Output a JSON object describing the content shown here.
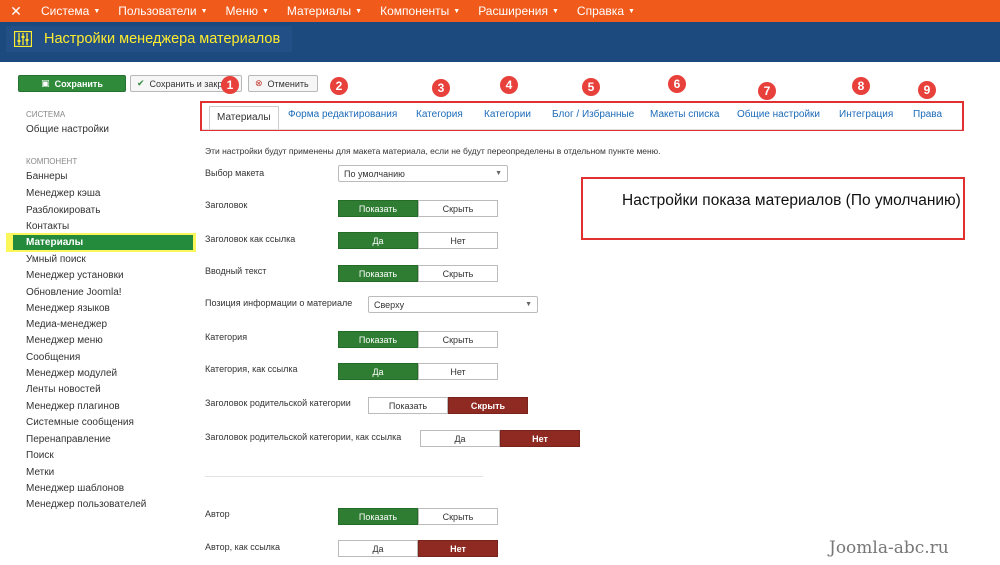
{
  "topnav": {
    "logo": "✕",
    "items": [
      "Система",
      "Пользователи",
      "Меню",
      "Материалы",
      "Компоненты",
      "Расширения",
      "Справка"
    ]
  },
  "header": {
    "title": "Настройки менеджера материалов"
  },
  "toolbar": {
    "save": "Сохранить",
    "save_close": "Сохранить и закрыть",
    "cancel": "Отменить"
  },
  "sidebar": {
    "system_heading": "Система",
    "system_items": [
      "Общие настройки"
    ],
    "component_heading": "Компонент",
    "component_items": [
      "Баннеры",
      "Менеджер кэша",
      "Разблокировать",
      "Контакты",
      "Материалы",
      "Умный поиск",
      "Менеджер установки",
      "Обновление Joomla!",
      "Менеджер языков",
      "Медиа-менеджер",
      "Менеджер меню",
      "Сообщения",
      "Менеджер модулей",
      "Ленты новостей",
      "Менеджер плагинов",
      "Системные сообщения",
      "Перенаправление",
      "Поиск",
      "Метки",
      "Менеджер шаблонов",
      "Менеджер пользователей"
    ],
    "active": "Материалы"
  },
  "tabs": [
    "Материалы",
    "Форма редактирования",
    "Категория",
    "Категории",
    "Блог / Избранные",
    "Макеты списка",
    "Общие настройки",
    "Интеграция",
    "Права"
  ],
  "badges": [
    "1",
    "2",
    "3",
    "4",
    "5",
    "6",
    "7",
    "8",
    "9"
  ],
  "form": {
    "notice": "Эти настройки будут применены для макета материала, если не будут переопределены в отдельном пункте меню.",
    "layout_label": "Выбор макета",
    "layout_value": "По умолчанию",
    "title_label": "Заголовок",
    "title_link_label": "Заголовок как ссылка",
    "intro_label": "Вводный текст",
    "info_pos_label": "Позиция информации о материале",
    "info_pos_value": "Сверху",
    "category_label": "Категория",
    "category_link_label": "Категория, как ссылка",
    "parent_label": "Заголовок родительской категории",
    "parent_link_label": "Заголовок родительской категории, как ссылка",
    "author_label": "Автор",
    "author_link_label": "Автор, как ссылка",
    "show": "Показать",
    "hide": "Скрыть",
    "yes": "Да",
    "no": "Нет"
  },
  "callout": "Настройки показа материалов (По умолчанию)",
  "watermark": "Joomla-abc.ru",
  "colors": {
    "topnav": "#f05a1a",
    "header": "#1d4a7e",
    "title": "#ffec2e",
    "green": "#2e7d32",
    "red": "#8e2a22",
    "annotation": "#e03030"
  }
}
